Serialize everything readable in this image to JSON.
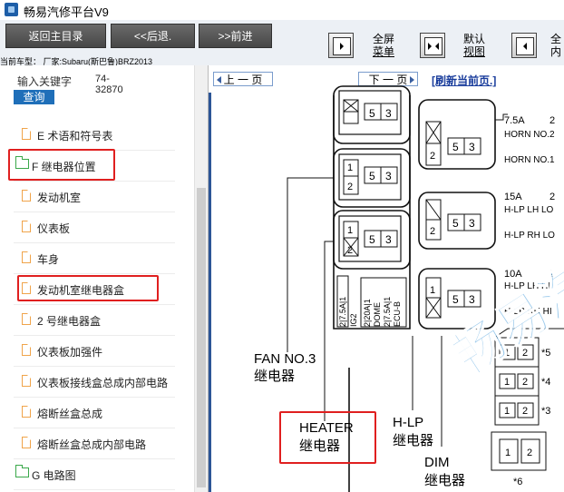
{
  "app": {
    "title": "畅易汽修平台V9"
  },
  "toolbar": {
    "back_main_label": "返回主目录",
    "back_label": "<<后退.",
    "forward_label": ">>前进",
    "fullscreen_menu_line1": "全屏",
    "fullscreen_menu_line2": "菜单",
    "default_view_line1": "默认",
    "default_view_line2": "视图",
    "fullscreen_content_line1": "全",
    "fullscreen_content_line2": "内",
    "current_vehicle": "当前车型： 厂家:Subaru(斯巴鲁)BRZ2013"
  },
  "search": {
    "label": "输入关键字",
    "value_line1": "74-",
    "value_line2": "32870",
    "button_label": "查询"
  },
  "tree": {
    "items": [
      {
        "label": "E 术语和符号表"
      },
      {
        "label": "F 继电器位置"
      },
      {
        "label": "发动机室"
      },
      {
        "label": "仪表板"
      },
      {
        "label": "车身"
      },
      {
        "label": "发动机室继电器盒"
      },
      {
        "label": "2 号继电器盒"
      },
      {
        "label": "仪表板加强件"
      },
      {
        "label": "仪表板接线盒总成内部电路"
      },
      {
        "label": "熔断丝盒总成"
      },
      {
        "label": "熔断丝盒总成内部电路"
      },
      {
        "label": "G 电路图"
      }
    ]
  },
  "viewer": {
    "prev_page": "上 一 页",
    "next_page": "下 一 页",
    "refresh": "[刷新当前页.]",
    "watermark": "畅易汽修",
    "diagram": {
      "relay_pins": {
        "p1": "1",
        "p2": "2",
        "p3": "3",
        "p5": "5"
      },
      "fuses": {
        "horn_amp": "7.5A",
        "horn_pos": "2",
        "horn_no2": "HORN NO.2",
        "horn_no1": "HORN NO.1",
        "hlp_lo_amp": "15A",
        "hlp_lo_pos": "2",
        "hlp_lh_lo": "H-LP LH LO",
        "hlp_rh_lo": "H-LP RH LO",
        "hlp_hi_amp": "10A",
        "hlp_hi_pos": "2",
        "hlp_lh_hi": "H-LP LH HI",
        "hlp_rh_hi": "H-LP RH HI"
      },
      "vertical_fuses": {
        "f1": "2|7.5A|1",
        "f1_name": "IG2",
        "f2": "2|20A|1",
        "f2_name": "DOME",
        "f3": "2|7.5A|1",
        "f3_name": "ECU-B"
      },
      "labels": {
        "fan_no3": "FAN NO.3",
        "relay": "继电器",
        "heater": "HEATER",
        "hlp": "H-LP",
        "dim": "DIM"
      },
      "side": {
        "s5": "*5",
        "s4": "*4",
        "s3": "*3",
        "s6": "*6"
      }
    }
  },
  "colors": {
    "highlight": "#e01f1f",
    "nav_bg": "#474747",
    "link": "#1a3d9c",
    "search_btn": "#1f6fb9",
    "watermark": "#4a9edc"
  }
}
